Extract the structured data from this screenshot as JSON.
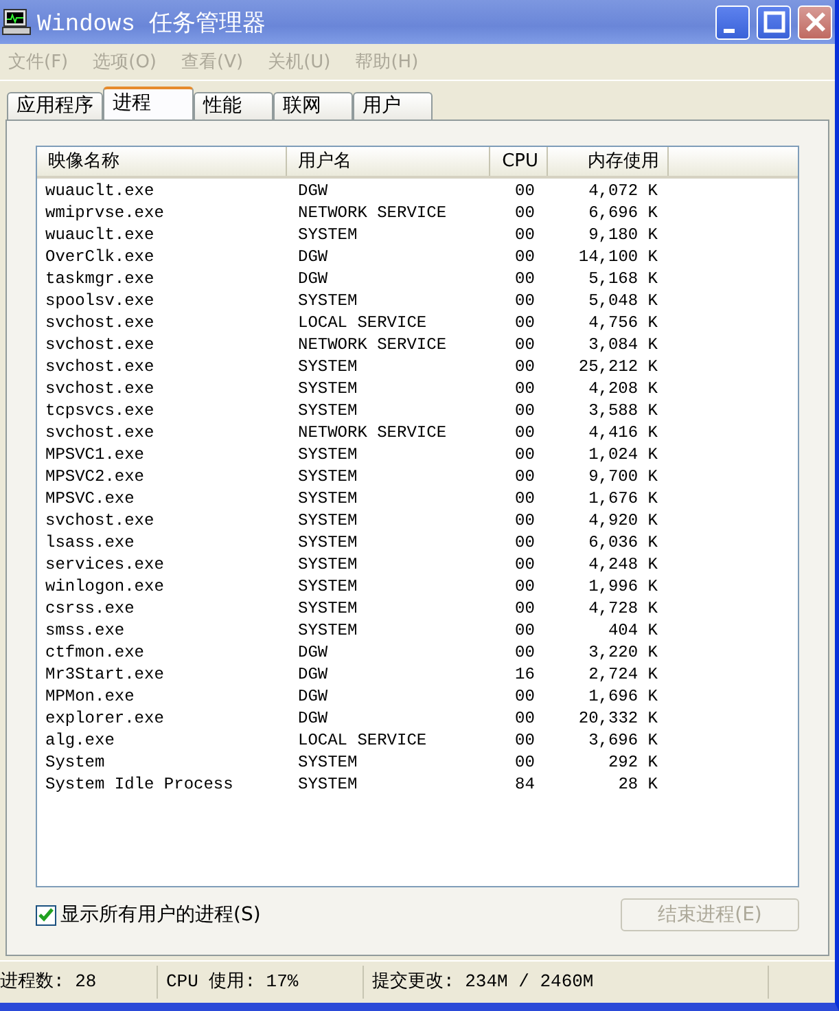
{
  "window": {
    "title": "Windows 任务管理器"
  },
  "menu": [
    {
      "label": "文件(F)",
      "disabled": true
    },
    {
      "label": "选项(O)",
      "disabled": true
    },
    {
      "label": "查看(V)",
      "disabled": true
    },
    {
      "label": "关机(U)",
      "disabled": true
    },
    {
      "label": "帮助(H)",
      "disabled": true
    }
  ],
  "tabs": [
    {
      "label": "应用程序",
      "selected": false
    },
    {
      "label": "进程",
      "selected": true
    },
    {
      "label": "性能",
      "selected": false
    },
    {
      "label": "联网",
      "selected": false
    },
    {
      "label": "用户",
      "selected": false
    }
  ],
  "table": {
    "columns": [
      "映像名称",
      "用户名",
      "CPU",
      "内存使用"
    ],
    "rows": [
      [
        "wuauclt.exe",
        "DGW",
        "00",
        "4,072 K"
      ],
      [
        "wmiprvse.exe",
        "NETWORK SERVICE",
        "00",
        "6,696 K"
      ],
      [
        "wuauclt.exe",
        "SYSTEM",
        "00",
        "9,180 K"
      ],
      [
        "OverClk.exe",
        "DGW",
        "00",
        "14,100 K"
      ],
      [
        "taskmgr.exe",
        "DGW",
        "00",
        "5,168 K"
      ],
      [
        "spoolsv.exe",
        "SYSTEM",
        "00",
        "5,048 K"
      ],
      [
        "svchost.exe",
        "LOCAL SERVICE",
        "00",
        "4,756 K"
      ],
      [
        "svchost.exe",
        "NETWORK SERVICE",
        "00",
        "3,084 K"
      ],
      [
        "svchost.exe",
        "SYSTEM",
        "00",
        "25,212 K"
      ],
      [
        "svchost.exe",
        "SYSTEM",
        "00",
        "4,208 K"
      ],
      [
        "tcpsvcs.exe",
        "SYSTEM",
        "00",
        "3,588 K"
      ],
      [
        "svchost.exe",
        "NETWORK SERVICE",
        "00",
        "4,416 K"
      ],
      [
        "MPSVC1.exe",
        "SYSTEM",
        "00",
        "1,024 K"
      ],
      [
        "MPSVC2.exe",
        "SYSTEM",
        "00",
        "9,700 K"
      ],
      [
        "MPSVC.exe",
        "SYSTEM",
        "00",
        "1,676 K"
      ],
      [
        "svchost.exe",
        "SYSTEM",
        "00",
        "4,920 K"
      ],
      [
        "lsass.exe",
        "SYSTEM",
        "00",
        "6,036 K"
      ],
      [
        "services.exe",
        "SYSTEM",
        "00",
        "4,248 K"
      ],
      [
        "winlogon.exe",
        "SYSTEM",
        "00",
        "1,996 K"
      ],
      [
        "csrss.exe",
        "SYSTEM",
        "00",
        "4,728 K"
      ],
      [
        "smss.exe",
        "SYSTEM",
        "00",
        "404 K"
      ],
      [
        "ctfmon.exe",
        "DGW",
        "00",
        "3,220 K"
      ],
      [
        "Mr3Start.exe",
        "DGW",
        "16",
        "2,724 K"
      ],
      [
        "MPMon.exe",
        "DGW",
        "00",
        "1,696 K"
      ],
      [
        "explorer.exe",
        "DGW",
        "00",
        "20,332 K"
      ],
      [
        "alg.exe",
        "LOCAL SERVICE",
        "00",
        "3,696 K"
      ],
      [
        "System",
        "SYSTEM",
        "00",
        "292 K"
      ],
      [
        "System Idle Process",
        "SYSTEM",
        "84",
        "28 K"
      ]
    ]
  },
  "show_all_users": {
    "label": "显示所有用户的进程(S)",
    "checked": true
  },
  "end_button": {
    "label": "结束进程(E)",
    "disabled": true
  },
  "status_bar": [
    "进程数: 28",
    "CPU 使用: 17%",
    "提交更改: 234M / 2460M"
  ]
}
